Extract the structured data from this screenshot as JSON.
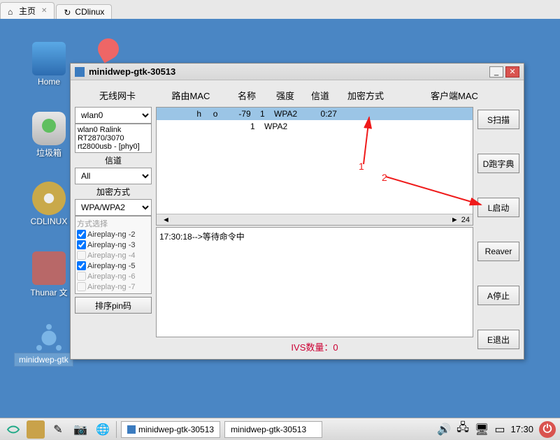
{
  "browser_tabs": [
    {
      "label": "主页",
      "icon": "⌂"
    },
    {
      "label": "CDlinux",
      "icon": "↻"
    }
  ],
  "desktop": {
    "home": "Home",
    "trash": "垃圾箱",
    "cdlinux": "CDLINUX",
    "thunar": "Thunar 文",
    "selapp": "minidwep-gtk"
  },
  "window": {
    "title": "minidwep-gtk-30513",
    "columns": {
      "wlan": "无线网卡",
      "mac": "路由MAC",
      "name": "名称",
      "strength": "强度",
      "channel": "信道",
      "enc": "加密方式",
      "client": "客户端MAC"
    },
    "wlan_value": "wlan0",
    "wlan_info": "wlan0 Ralink RT2870/3070 rt2800usb - [phy0]",
    "section_channel": "信道",
    "channel_value": "All",
    "section_enc": "加密方式",
    "enc_value": "WPA/WPA2",
    "attack_title": "方式选择",
    "attacks": [
      {
        "label": "Aireplay-ng  -2",
        "checked": true,
        "enabled": true
      },
      {
        "label": "Aireplay-ng  -3",
        "checked": true,
        "enabled": true
      },
      {
        "label": "Aireplay-ng  -4",
        "checked": false,
        "enabled": false
      },
      {
        "label": "Aireplay-ng  -5",
        "checked": true,
        "enabled": true
      },
      {
        "label": "Aireplay-ng  -6",
        "checked": false,
        "enabled": false
      },
      {
        "label": "Aireplay-ng  -7",
        "checked": false,
        "enabled": false
      }
    ],
    "pin_button": "排序pin码",
    "aplist": {
      "rows": [
        {
          "text": "                h     o         -79    1    WPA2          0:27",
          "selected": true
        },
        {
          "text": "                                       1    WPA2",
          "selected": false
        }
      ],
      "scroll_count": "24"
    },
    "log_line": "17:30:18-->等待命令中",
    "ivs": "IVS数量：0",
    "buttons": {
      "scan": "S扫描",
      "dict": "D跑字典",
      "start": "L启动",
      "reaver": "Reaver",
      "stop": "A停止",
      "exit": "E退出"
    }
  },
  "annotations": {
    "one": "1",
    "two": "2"
  },
  "taskbar": {
    "app_title": "minidwep-gtk-30513",
    "app_input": "minidwep-gtk-30513",
    "time": "17:30"
  }
}
